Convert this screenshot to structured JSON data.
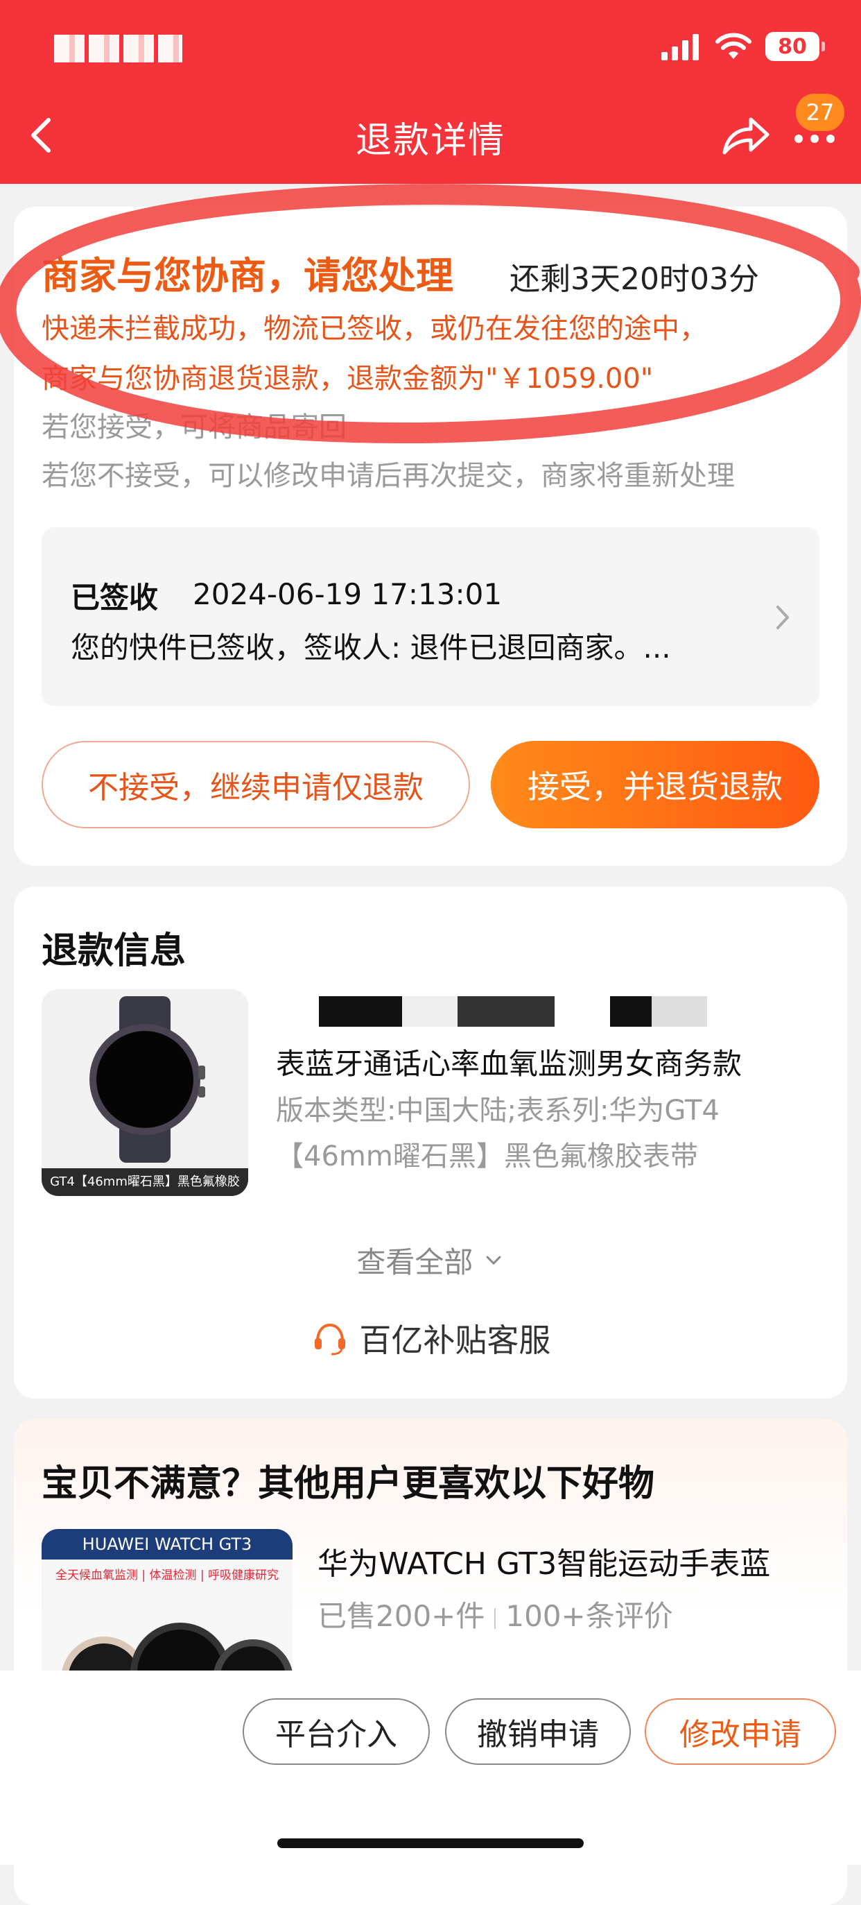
{
  "status_bar": {
    "battery": "80"
  },
  "nav": {
    "title": "退款详情",
    "badge_count": "27"
  },
  "status_card": {
    "title": "商家与您协商，请您处理",
    "remaining": "还剩3天20时03分",
    "desc_line1": "快递未拦截成功，物流已签收，或仍在发往您的途中，",
    "desc_line2": "商家与您协商退货退款，退款金额为\"￥1059.00\"",
    "hint_accept": "若您接受，可将商品寄回",
    "hint_reject": "若您不接受，可以修改申请后再次提交，商家将重新处理",
    "logistics": {
      "status": "已签收",
      "time": "2024-06-19 17:13:01",
      "detail": "您的快件已签收，签收人: 退件已退回商家。..."
    },
    "reject_button": "不接受，继续申请仅退款",
    "accept_button": "接受，并退货退款"
  },
  "refund_info": {
    "title": "退款信息",
    "product_image_label": "GT4【46mm曜石黑】黑色氟橡胶",
    "product_name": "表蓝牙通话心率血氧监测男女商务款",
    "product_spec": "版本类型:中国大陆;表系列:华为GT4【46mm曜石黑】黑色氟橡胶表带",
    "view_all": "查看全部",
    "service": "百亿补贴客服"
  },
  "recommend": {
    "title": "宝贝不满意？其他用户更喜欢以下好物",
    "image_brand": "HUAWEI WATCH GT3",
    "image_tagline": "全天候血氧监测 | 体温检测 | 呼吸健康研究",
    "item_name": "华为WATCH GT3智能运动手表蓝",
    "sold": "已售200+件",
    "reviews": "100+条评价"
  },
  "bottom_bar": {
    "platform": "平台介入",
    "cancel": "撤销申请",
    "modify": "修改申请"
  }
}
